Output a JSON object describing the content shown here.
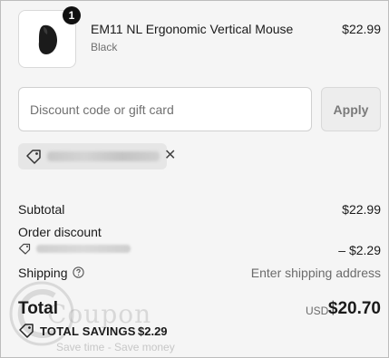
{
  "product": {
    "quantity": "1",
    "name": "EM11 NL Ergonomic Vertical Mouse",
    "variant": "Black",
    "price": "$22.99"
  },
  "discount": {
    "placeholder": "Discount code or gift card",
    "value": "",
    "apply_label": "Apply",
    "applied_code_remove": "✕"
  },
  "summary": {
    "subtotal_label": "Subtotal",
    "subtotal_value": "$22.99",
    "order_discount_label": "Order discount",
    "order_discount_value": "– $2.29",
    "shipping_label": "Shipping",
    "shipping_value": "Enter shipping address",
    "total_label": "Total",
    "currency": "USD",
    "total_value": "$20.70",
    "savings_label": "TOTAL SAVINGS",
    "savings_value": "$2.29"
  },
  "watermark": {
    "word": "Coupon",
    "tagline": "Save time - Save money"
  },
  "colors": {
    "background": "#f5f5f5",
    "badge": "#111111",
    "apply_button": "#ededed"
  }
}
